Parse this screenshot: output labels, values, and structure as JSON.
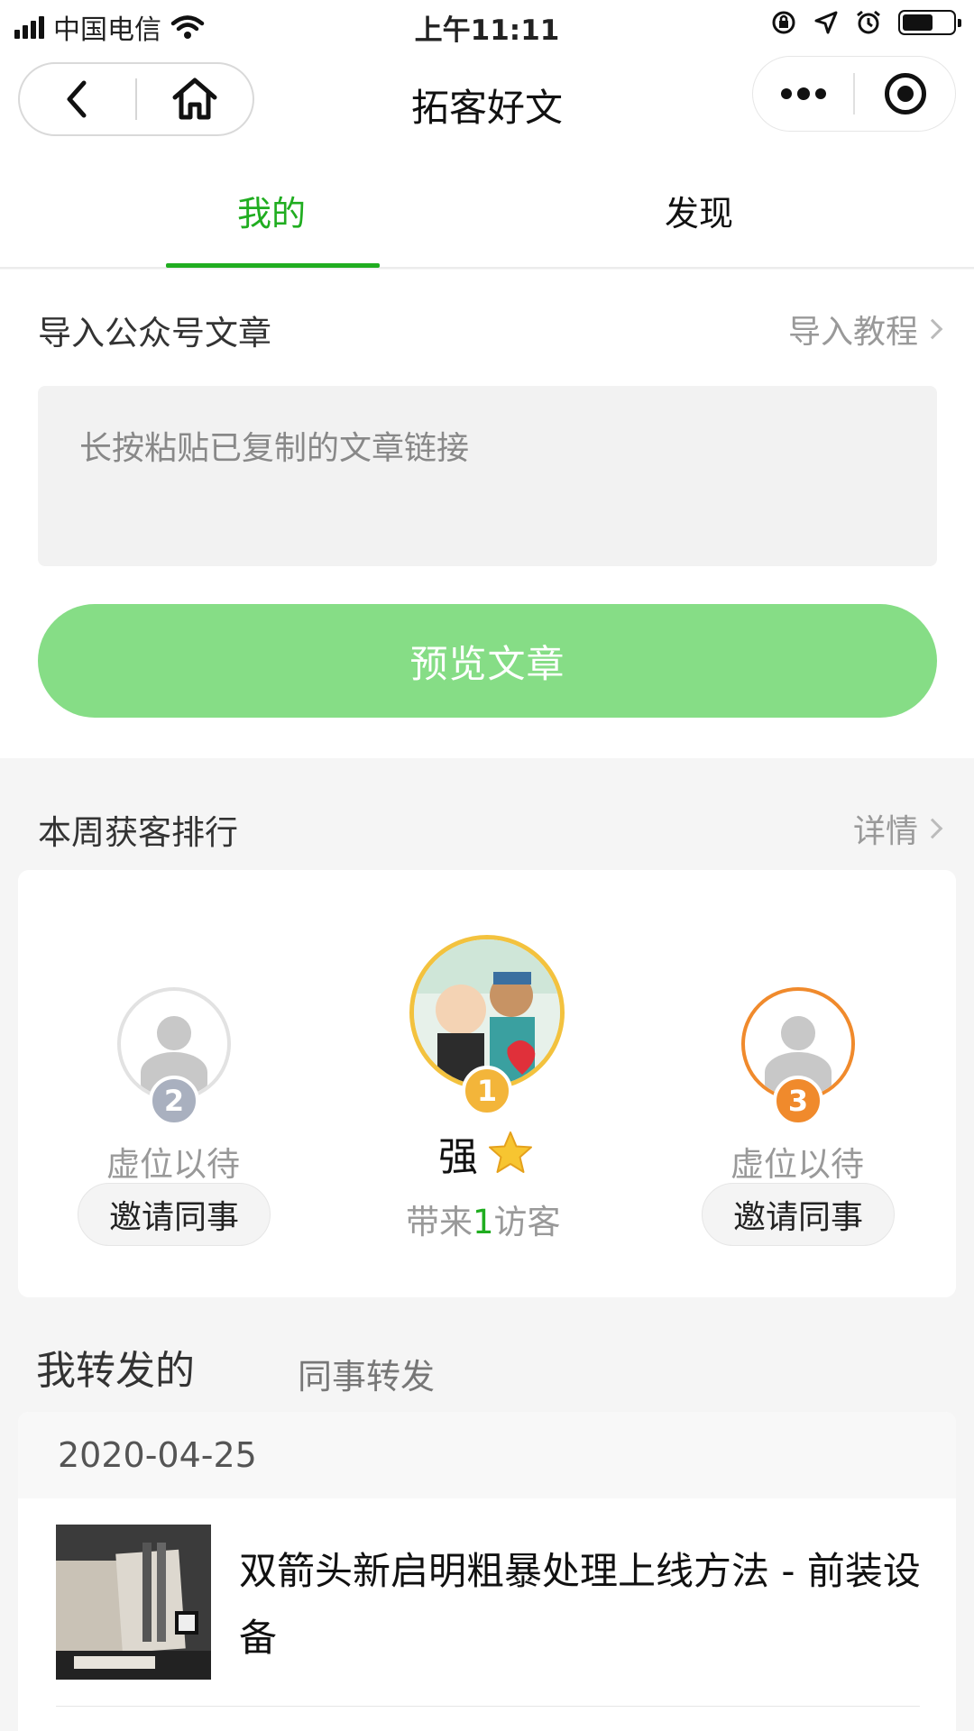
{
  "status_bar": {
    "carrier": "中国电信",
    "time": "上午11:11",
    "battery_level": 0.55,
    "icons": [
      "signal-icon",
      "wifi-icon",
      "rotation-lock-icon",
      "location-icon",
      "alarm-icon",
      "battery-icon"
    ]
  },
  "nav": {
    "title": "拓客好文",
    "icons": [
      "back-icon",
      "home-icon",
      "more-icon",
      "close-miniprogram-icon"
    ]
  },
  "tabs": [
    {
      "label": "我的",
      "active": true
    },
    {
      "label": "发现",
      "active": false
    }
  ],
  "import": {
    "title": "导入公众号文章",
    "tutorial_link": "导入教程",
    "input_placeholder": "长按粘贴已复制的文章链接",
    "preview_button": "预览文章"
  },
  "ranking": {
    "title": "本周获客排行",
    "details_link": "详情",
    "entries": [
      {
        "rank": "1",
        "name": "强",
        "visitors_prefix": "带来",
        "visitors_count": "1",
        "visitors_suffix": "访客"
      },
      {
        "rank": "2",
        "name": "虚位以待",
        "invite_button": "邀请同事"
      },
      {
        "rank": "3",
        "name": "虚位以待",
        "invite_button": "邀请同事"
      }
    ],
    "colors": {
      "gold": "#f3b53a",
      "silver": "#a9b0bf",
      "bronze": "#f08a2c",
      "green_count": "#20ad20"
    }
  },
  "forwards": {
    "tab_mine": "我转发的",
    "tab_colleague": "同事转发",
    "date": "2020-04-25",
    "articles": [
      {
        "title": "双箭头新启明粗暴处理上线方法 - 前装设备"
      }
    ]
  },
  "colors": {
    "accent_green": "#20ad20",
    "preview_button": "#86dd86"
  }
}
